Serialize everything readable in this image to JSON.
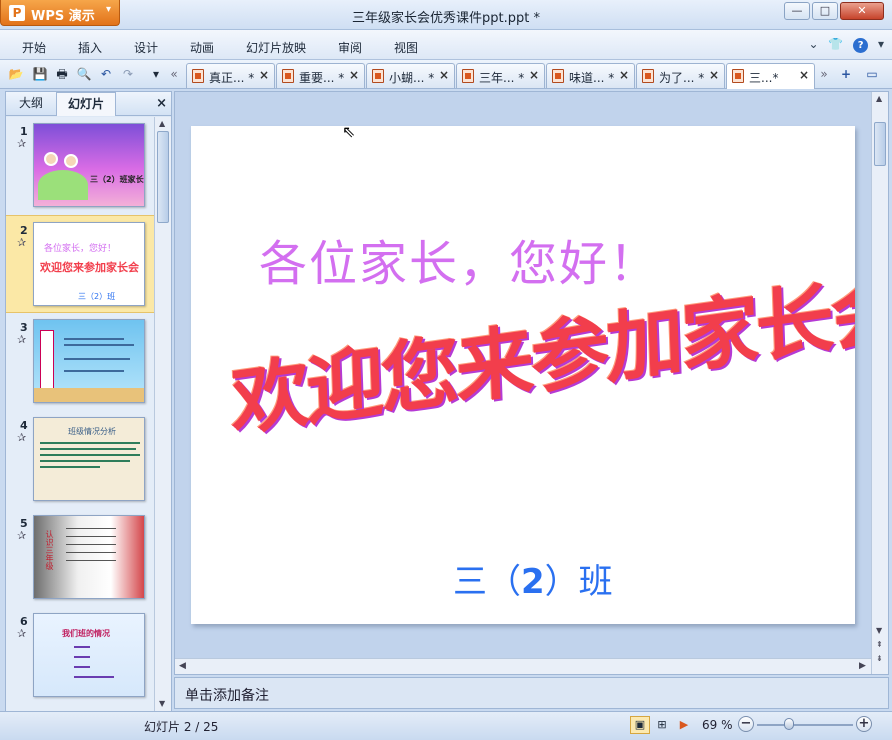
{
  "app": {
    "name": "WPS 演示",
    "logo_glyph": "P"
  },
  "window": {
    "title": "三年级家长会优秀课件ppt.ppt *"
  },
  "menu": {
    "items": [
      "开始",
      "插入",
      "设计",
      "动画",
      "幻灯片放映",
      "审阅",
      "视图"
    ]
  },
  "tabs": [
    {
      "label": "真正... *"
    },
    {
      "label": "重要... *"
    },
    {
      "label": "小蝴... *"
    },
    {
      "label": "三年... *"
    },
    {
      "label": "味道... *"
    },
    {
      "label": "为了... *"
    },
    {
      "label": "三...*"
    }
  ],
  "left_panel": {
    "tab_outline": "大纲",
    "tab_slides": "幻灯片",
    "thumbnails": [
      {
        "num": "1",
        "text": "三（2）班家长会"
      },
      {
        "num": "2",
        "text1": "各位家长，您好！",
        "text2": "欢迎您来参加家长会",
        "text3": "三（2）班"
      },
      {
        "num": "3"
      },
      {
        "num": "4",
        "text": "班级情况分析"
      },
      {
        "num": "5",
        "text": "认识三年级"
      },
      {
        "num": "6",
        "text": "我们班的情况"
      }
    ]
  },
  "slide": {
    "greeting": "各位家长，您好！",
    "welcome": "欢迎您来参加家长会",
    "class_prefix": "三（",
    "class_number": "2",
    "class_suffix": "）班"
  },
  "notes": {
    "placeholder": "单击添加备注"
  },
  "status": {
    "slide_counter": "幻灯片 2 / 25",
    "zoom": "69 %"
  },
  "colors": {
    "accent": "#e2731a",
    "greeting": "#d36ff0",
    "welcome": "#f23e4c",
    "class": "#2a70f0"
  }
}
